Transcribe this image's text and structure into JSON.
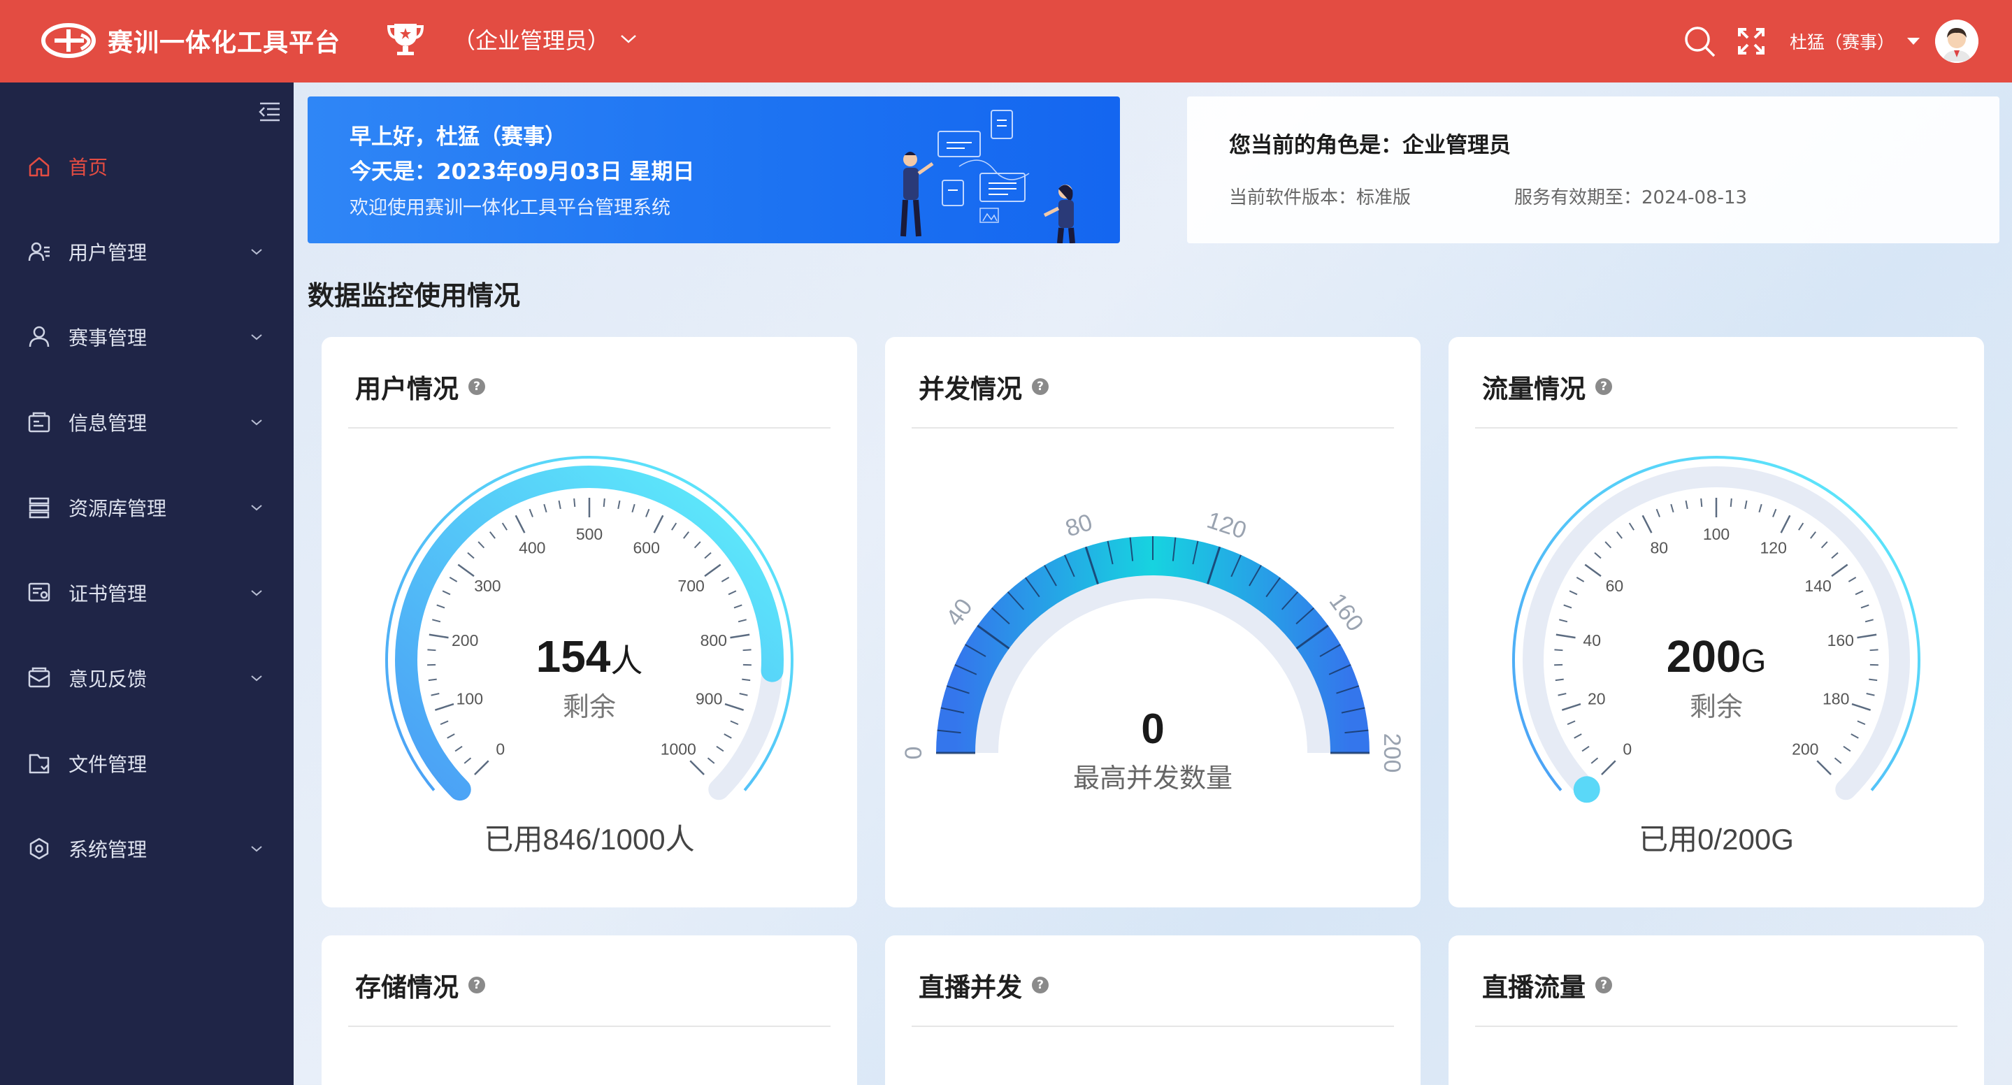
{
  "header": {
    "app_title": "赛训一体化工具平台",
    "role_label": "（企业管理员）",
    "user_name": "杜猛（赛事）",
    "icons": [
      "search-icon",
      "fullscreen-icon",
      "avatar"
    ]
  },
  "sidebar": {
    "items": [
      {
        "label": "首页",
        "icon": "home-icon",
        "active": true,
        "has_children": false
      },
      {
        "label": "用户管理",
        "icon": "user-icon",
        "active": false,
        "has_children": true
      },
      {
        "label": "赛事管理",
        "icon": "person-icon",
        "active": false,
        "has_children": true
      },
      {
        "label": "信息管理",
        "icon": "info-icon",
        "active": false,
        "has_children": true
      },
      {
        "label": "资源库管理",
        "icon": "database-icon",
        "active": false,
        "has_children": true
      },
      {
        "label": "证书管理",
        "icon": "certificate-icon",
        "active": false,
        "has_children": true
      },
      {
        "label": "意见反馈",
        "icon": "feedback-icon",
        "active": false,
        "has_children": true
      },
      {
        "label": "文件管理",
        "icon": "folder-icon",
        "active": false,
        "has_children": false
      },
      {
        "label": "系统管理",
        "icon": "settings-icon",
        "active": false,
        "has_children": true
      }
    ]
  },
  "welcome": {
    "greeting": "早上好，杜猛（赛事）",
    "date_line": "今天是：2023年09月03日 星期日",
    "subtitle": "欢迎使用赛训一体化工具平台管理系统"
  },
  "role_card": {
    "title": "您当前的角色是：企业管理员",
    "version": "当前软件版本：标准版",
    "expiry": "服务有效期至：2024-08-13"
  },
  "section_title": "数据监控使用情况",
  "cards": [
    {
      "title": "用户情况",
      "gauge": {
        "value": 154,
        "unit": "人",
        "label": "剩余",
        "min": 0,
        "max": 1000,
        "ticks": [
          "0",
          "100",
          "200",
          "300",
          "400",
          "500",
          "600",
          "700",
          "800",
          "900",
          "1000"
        ],
        "fill_ratio": 0.846,
        "footer": "已用846/1000人"
      }
    },
    {
      "title": "并发情况",
      "gauge": {
        "value": "0",
        "label": "最高并发数量",
        "min": 0,
        "max": 200,
        "ticks": [
          "0",
          "40",
          "80",
          "120",
          "160",
          "200"
        ]
      }
    },
    {
      "title": "流量情况",
      "gauge": {
        "value": 200,
        "unit": "G",
        "label": "剩余",
        "min": 0,
        "max": 200,
        "ticks": [
          "0",
          "20",
          "40",
          "60",
          "80",
          "100",
          "120",
          "140",
          "160",
          "180",
          "200"
        ],
        "fill_ratio": 0.0,
        "footer": "已用0/200G"
      }
    },
    {
      "title": "存储情况"
    },
    {
      "title": "直播并发"
    },
    {
      "title": "直播流量"
    }
  ],
  "colors": {
    "header_bg": "#e34c42",
    "sidebar_bg": "#1f2547",
    "accent_red": "#e34c42",
    "gauge_cyan": "#5ee0f7",
    "gauge_blue": "#3a8bf2"
  }
}
